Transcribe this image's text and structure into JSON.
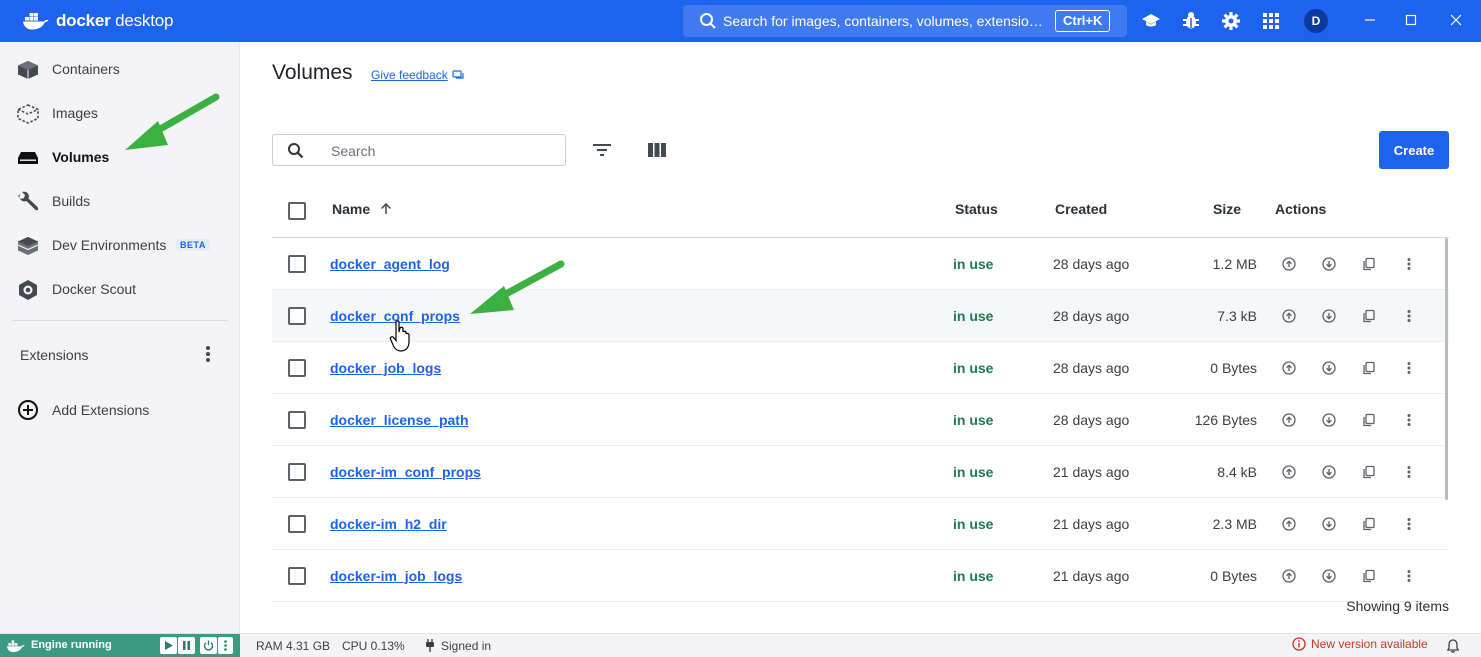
{
  "app": {
    "brand_prefix": "docker",
    "brand_suffix": "desktop"
  },
  "titlebar": {
    "search_text": "Search for images, containers, volumes, extensio…",
    "shortcut": "Ctrl+K",
    "avatar_initial": "D"
  },
  "sidebar": {
    "items": [
      {
        "label": "Containers",
        "icon": "containers-icon"
      },
      {
        "label": "Images",
        "icon": "images-icon"
      },
      {
        "label": "Volumes",
        "icon": "volumes-icon"
      },
      {
        "label": "Builds",
        "icon": "builds-icon"
      },
      {
        "label": "Dev Environments",
        "icon": "dev-environments-icon",
        "badge": "BETA"
      },
      {
        "label": "Docker Scout",
        "icon": "docker-scout-icon"
      }
    ],
    "extensions_label": "Extensions",
    "add_extensions_label": "Add Extensions"
  },
  "main": {
    "title": "Volumes",
    "feedback_label": "Give feedback",
    "search_placeholder": "Search",
    "create_label": "Create",
    "columns": {
      "name": "Name",
      "status": "Status",
      "created": "Created",
      "size": "Size",
      "actions": "Actions"
    },
    "rows": [
      {
        "name": "docker_agent_log",
        "status": "in use",
        "created": "28 days ago",
        "size": "1.2 MB"
      },
      {
        "name": "docker_conf_props",
        "status": "in use",
        "created": "28 days ago",
        "size": "7.3 kB"
      },
      {
        "name": "docker_job_logs",
        "status": "in use",
        "created": "28 days ago",
        "size": "0 Bytes"
      },
      {
        "name": "docker_license_path",
        "status": "in use",
        "created": "28 days ago",
        "size": "126 Bytes"
      },
      {
        "name": "docker-im_conf_props",
        "status": "in use",
        "created": "21 days ago",
        "size": "8.4 kB"
      },
      {
        "name": "docker-im_h2_dir",
        "status": "in use",
        "created": "21 days ago",
        "size": "2.3 MB"
      },
      {
        "name": "docker-im_job_logs",
        "status": "in use",
        "created": "21 days ago",
        "size": "0 Bytes"
      }
    ],
    "showing_text": "Showing 9 items"
  },
  "statusbar": {
    "engine_label": "Engine running",
    "ram": "RAM 4.31 GB",
    "cpu": "CPU 0.13%",
    "signed_in": "Signed in",
    "new_version": "New version available"
  },
  "colors": {
    "brand_blue": "#1d63ed",
    "status_green": "#1e7a54",
    "engine_green": "#3d9a82",
    "annotation_arrow": "#3cb043"
  }
}
